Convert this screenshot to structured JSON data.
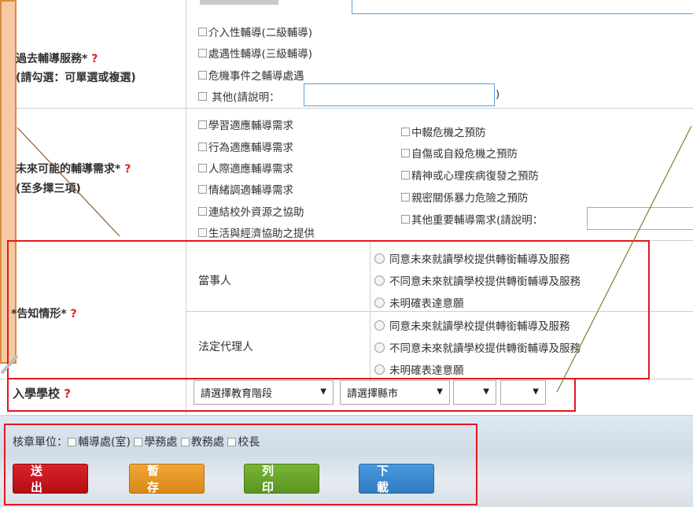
{
  "past_service": {
    "label": "過去輔導服務*",
    "sublabel": "(請勾選：可單選或複選)",
    "options": [
      "介入性輔導(二級輔導)",
      "處遇性輔導(三級輔導)",
      "危機事件之輔導處遇",
      "其他(請說明：",
      ")"
    ]
  },
  "future_needs": {
    "label": "未來可能的輔導需求*",
    "sublabel": "(至多擇三項)",
    "left_options": [
      "學習適應輔導需求",
      "行為適應輔導需求",
      "人際適應輔導需求",
      "情緒調適輔導需求",
      "連結校外資源之協助",
      "生活與經濟協助之提供"
    ],
    "right_options": [
      "中輟危機之預防",
      "自傷或自殺危機之預防",
      "精神或心理疾病復發之預防",
      "親密關係暴力危險之預防",
      "其他重要輔導需求(請說明："
    ]
  },
  "notify": {
    "label": "*告知情形*",
    "party_label": "當事人",
    "guardian_label": "法定代理人",
    "options": [
      "同意未來就讀學校提供轉銜輔導及服務",
      "不同意未來就讀學校提供轉銜輔導及服務",
      "未明確表達意願"
    ]
  },
  "school": {
    "label": "入學學校",
    "selects": [
      "請選擇教育階段",
      "請選擇縣市",
      "",
      ""
    ]
  },
  "approval": {
    "label": "核章單位：",
    "options": [
      "輔導處(室)",
      "學務處",
      "教務處",
      "校長"
    ]
  },
  "buttons": {
    "submit": "送出",
    "save": "暫存",
    "print": "列印",
    "download": "下載"
  },
  "required_mark": "?",
  "colors": {
    "submit": "#c8121b",
    "save": "#e69720",
    "print": "#6aa529",
    "download": "#3d8ad1",
    "highlight": "#e3161e"
  }
}
